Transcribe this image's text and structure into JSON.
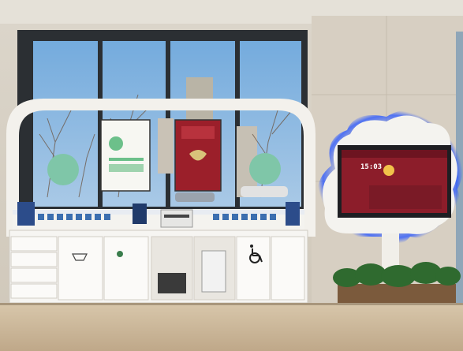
{
  "scene": {
    "description_tags": [
      "service-counter",
      "window",
      "digital-kiosk",
      "plants"
    ]
  },
  "kiosk_screen": {
    "time": "15:03",
    "icons": [
      "clock-icon",
      "weather-sun-icon"
    ]
  },
  "colors": {
    "sky": "#7fb3e0",
    "panel_white": "#f4f3ef",
    "screen_red": "#8c1d2a",
    "wall_beige": "#d8d2c7",
    "floor": "#c9b79a",
    "kiosk_glow": "#2e5bff"
  }
}
